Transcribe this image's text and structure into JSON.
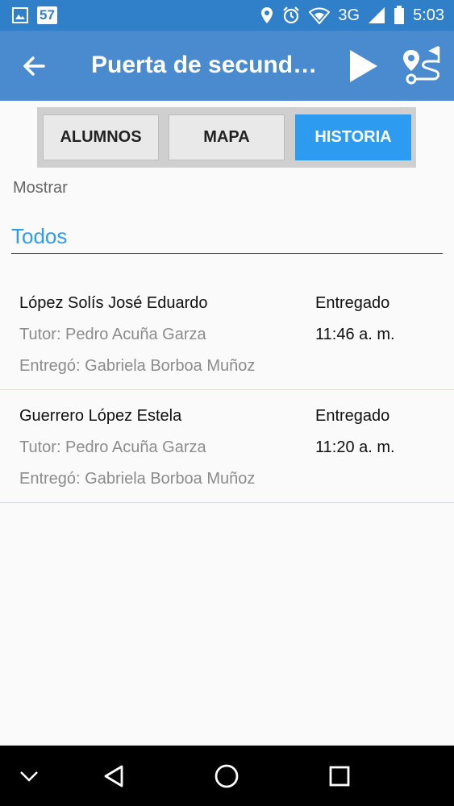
{
  "status_bar": {
    "notification_count": "57",
    "network": "3G",
    "time": "5:03",
    "icons": [
      "gallery-icon",
      "location-icon",
      "alarm-icon",
      "wifi-icon",
      "signal-icon",
      "battery-icon"
    ]
  },
  "app_bar": {
    "title": "Puerta de secundaria",
    "icons": [
      "back-arrow-icon",
      "play-icon",
      "route-icon"
    ]
  },
  "tabs": [
    {
      "label": "ALUMNOS",
      "active": false
    },
    {
      "label": "MAPA",
      "active": false
    },
    {
      "label": "HISTORIA",
      "active": true
    }
  ],
  "filter": {
    "label": "Mostrar",
    "selected": "Todos"
  },
  "records": [
    {
      "name": "López Solís José Eduardo",
      "tutor": "Tutor: Pedro Acuña Garza",
      "delivered_by": "Entregó: Gabriela Borboa Muñoz",
      "status": "Entregado",
      "time": "11:46 a. m."
    },
    {
      "name": "Guerrero López Estela",
      "tutor": "Tutor: Pedro Acuña Garza",
      "delivered_by": "Entregó: Gabriela Borboa Muñoz",
      "status": "Entregado",
      "time": "11:20 a. m."
    }
  ],
  "nav_bar": {
    "icons": [
      "collapse-chevron-icon",
      "back-triangle-icon",
      "home-circle-icon",
      "recents-square-icon"
    ]
  },
  "colors": {
    "status_bar": "#2f80c9",
    "app_bar": "#4a8bd0",
    "accent": "#2d9cf0"
  }
}
